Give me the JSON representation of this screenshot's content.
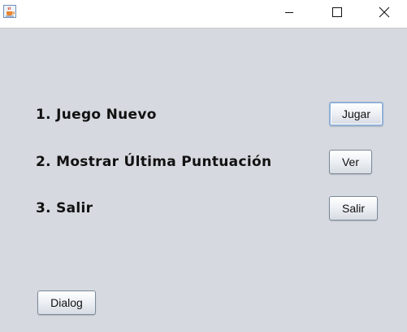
{
  "window": {
    "icon": "java-cup-icon",
    "controls": {
      "minimize_icon": "minimize-icon",
      "maximize_icon": "maximize-icon",
      "close_icon": "close-icon"
    }
  },
  "menu": {
    "items": [
      {
        "label": "1. Juego Nuevo",
        "button": "Jugar"
      },
      {
        "label": "2. Mostrar Última Puntuación",
        "button": "Ver"
      },
      {
        "label": "3. Salir",
        "button": "Salir"
      }
    ]
  },
  "dialog_button": "Dialog",
  "colors": {
    "background": "#d6d9df",
    "focus_border": "#90b0d8"
  }
}
